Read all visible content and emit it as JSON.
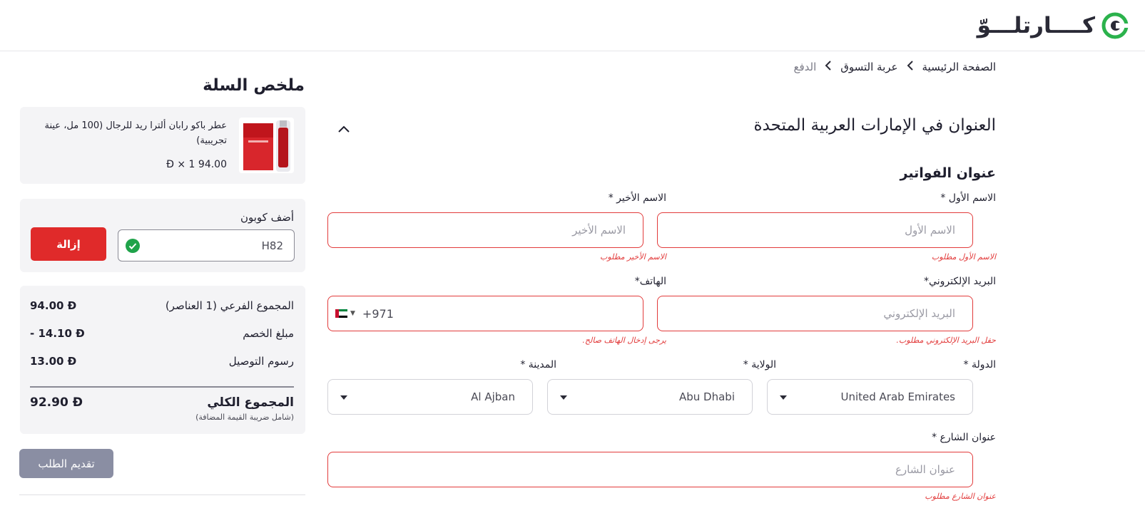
{
  "header": {
    "logo_text": "كــــارتلـــوّ",
    "logo_icon": "cartlow-logo-icon",
    "accent_color": "#2bb24c"
  },
  "breadcrumb": {
    "items": [
      {
        "label": "الصفحة الرئيسية"
      },
      {
        "label": "عربة التسوق"
      },
      {
        "label": "الدفع"
      }
    ],
    "separator_icon": "chevron-left-icon"
  },
  "address": {
    "title": "العنوان في الإمارات العربية المتحدة",
    "collapse_icon": "chevron-up-icon",
    "billing_title": "عنوان الفواتير",
    "first_name": {
      "label": "الاسم الأول *",
      "placeholder": "الاسم الأول",
      "value": "",
      "error": "الاسم الأول مطلوب"
    },
    "last_name": {
      "label": "الاسم الأخير *",
      "placeholder": "الاسم الأخير",
      "value": "",
      "error": "الاسم الأخير مطلوب"
    },
    "email": {
      "label": "البريد الإلكتروني*",
      "placeholder": "البريد الإلكتروني",
      "value": "",
      "error": "حقل البريد الإلكتروني مطلوب."
    },
    "phone": {
      "label": "الهاتف*",
      "country_code": "+971",
      "flag_icon": "uae-flag-icon",
      "value": "",
      "error": "يرجى إدخال الهاتف صالح."
    },
    "country": {
      "label": "الدولة *",
      "value": "United Arab Emirates"
    },
    "state": {
      "label": "الولاية *",
      "value": "Abu Dhabi"
    },
    "city": {
      "label": "المدينة *",
      "value": "Al Ajban"
    },
    "street": {
      "label": "عنوان الشارع *",
      "placeholder": "عنوان الشارع",
      "value": "",
      "error": "عنوان الشارع مطلوب"
    }
  },
  "cart": {
    "title": "ملخص السلة",
    "product": {
      "name": "عطر باكو رابان ألترا ريد للرجال (100 مل، عينة تجريبية)",
      "price_line": "94.00 Ð × 1"
    },
    "coupon": {
      "label": "أضف كوبون",
      "value": "H82",
      "status_icon": "check-circle-icon",
      "remove_label": "إزالة"
    },
    "totals": {
      "subtotal_label": "المجموع الفرعي (1 العناصر)",
      "subtotal_value": "94.00 Ð",
      "discount_label": "مبلغ الخصم",
      "discount_value": "- 14.10 Ð",
      "shipping_label": "رسوم التوصيل",
      "shipping_value": "13.00 Ð",
      "grand_label": "المجموع الكلي",
      "grand_value": "92.90 Ð",
      "vat_note": "(شامل ضريبة القيمة المضافة)"
    },
    "submit_label": "تقديم الطلب"
  },
  "colors": {
    "error": "#e23b3b",
    "remove_button": "#e02a2a",
    "submit_button": "#8a8ea3",
    "panel_bg": "#f4f4f6"
  }
}
